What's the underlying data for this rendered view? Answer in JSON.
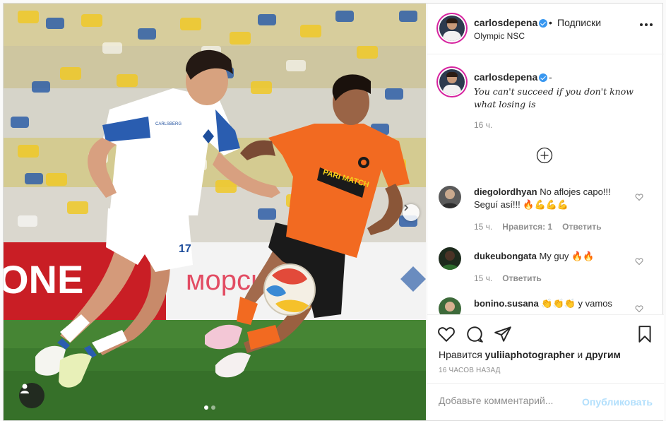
{
  "header": {
    "username": "carlosdepena",
    "separator": "•",
    "follow_label": "Подписки",
    "location": "Olympic NSC"
  },
  "caption": {
    "username": "carlosdepena",
    "dash": "-",
    "text": "You can't succeed if you don't know what losing is",
    "time": "16 ч."
  },
  "comments": [
    {
      "username": "diegolordhyan",
      "text": "No aflojes capo!!! Seguí así!!! 🔥💪💪💪",
      "time": "15 ч.",
      "likes": "Нравится: 1",
      "reply": "Ответить"
    },
    {
      "username": "dukeubongata",
      "text": "My guy 🔥🔥",
      "time": "15 ч.",
      "likes": "",
      "reply": "Ответить"
    },
    {
      "username": "bonino.susana",
      "text": "👏👏👏 y vamos",
      "time": "",
      "likes": "",
      "reply": ""
    }
  ],
  "likes": {
    "prefix": "Нравится",
    "user": "yuliiaphotographer",
    "connector": "и",
    "others": "другим"
  },
  "posted_ago": "16 часов назад",
  "comment_input": {
    "placeholder": "Добавьте комментарий...",
    "publish_label": "Опубликовать"
  },
  "photo": {
    "banner_text": "морська",
    "sponsor_text": "PARI MATCH",
    "left_banner_text": "ONE",
    "brand_text": "CARLSBERG",
    "player_number": "17",
    "carousel_total": 2,
    "carousel_active": 1
  },
  "colors": {
    "accent": "#3897f0",
    "publish_disabled": "#b2dffc",
    "shakhtar_orange": "#f26a21",
    "dynamo_blue": "#1e4e9c"
  }
}
